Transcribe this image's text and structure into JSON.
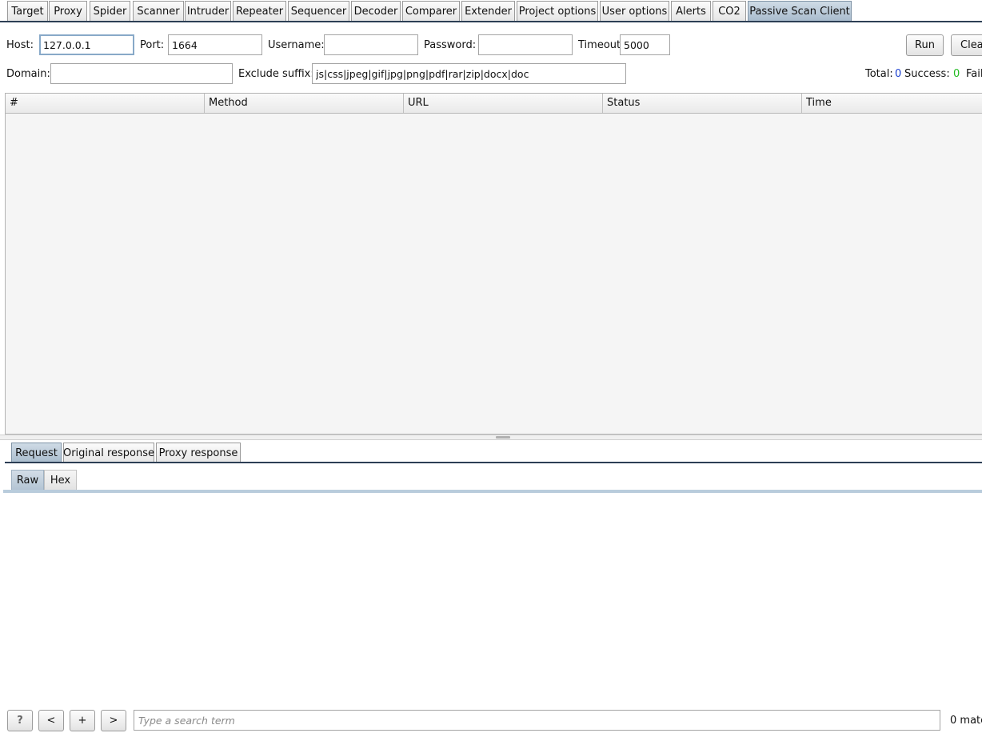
{
  "tabs": [
    "Target",
    "Proxy",
    "Spider",
    "Scanner",
    "Intruder",
    "Repeater",
    "Sequencer",
    "Decoder",
    "Comparer",
    "Extender",
    "Project options",
    "User options",
    "Alerts",
    "CO2",
    "Passive Scan Client"
  ],
  "active_tab": "Passive Scan Client",
  "form": {
    "host_label": "Host:",
    "host_value": "127.0.0.1",
    "port_label": "Port:",
    "port_value": "1664",
    "username_label": "Username:",
    "username_value": "",
    "password_label": "Password:",
    "password_value": "",
    "timeout_label": "Timeout:",
    "timeout_value": "5000",
    "domain_label": "Domain:",
    "domain_value": "",
    "exclude_label": "Exclude suffix:",
    "exclude_value": "js|css|jpeg|gif|jpg|png|pdf|rar|zip|docx|doc",
    "run_label": "Run",
    "clear_label": "Clea"
  },
  "stats": {
    "total_label": "Total:",
    "total_value": "0",
    "success_label": "Success:",
    "success_value": "0",
    "fail_label": "Fail",
    "total_color": "#1a3fd0",
    "success_color": "#22bb22"
  },
  "table": {
    "columns": [
      "#",
      "Method",
      "URL",
      "Status",
      "Time"
    ],
    "rows": []
  },
  "message_tabs": [
    "Request",
    "Original response",
    "Proxy response"
  ],
  "active_message_tab": "Request",
  "view_tabs": [
    "Raw",
    "Hex"
  ],
  "active_view_tab": "Raw",
  "bottom": {
    "help_label": "?",
    "prev_label": "<",
    "add_label": "+",
    "next_label": ">",
    "search_placeholder": "Type a search term",
    "matches_text": "0 matc"
  },
  "colors": {
    "accent_dark": "#2d3f55",
    "active_tab": "#b6c6d6"
  }
}
